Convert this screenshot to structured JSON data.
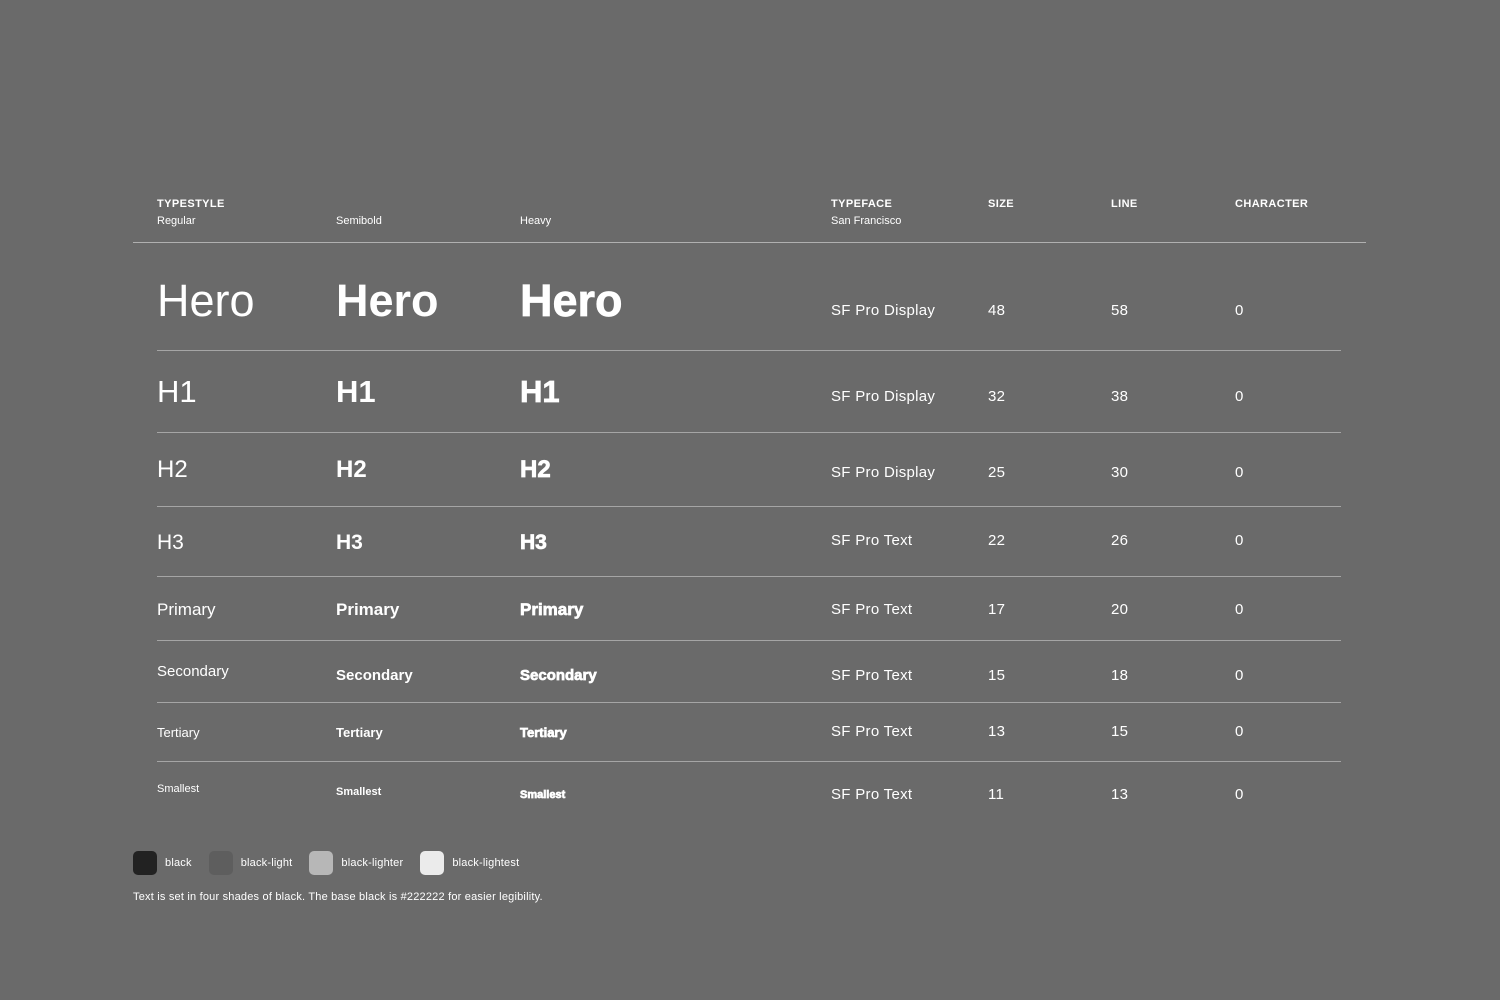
{
  "header": {
    "typestyle_label": "TYPESTYLE",
    "weights": [
      "Regular",
      "Semibold",
      "Heavy"
    ],
    "typeface_label": "TYPEFACE",
    "typeface_family": "San Francisco",
    "size_label": "SIZE",
    "line_label": "LINE",
    "character_label": "CHARACTER"
  },
  "rows": [
    {
      "name": "Hero",
      "typeface": "SF Pro Display",
      "size": "48",
      "line": "58",
      "character": "0"
    },
    {
      "name": "H1",
      "typeface": "SF Pro Display",
      "size": "32",
      "line": "38",
      "character": "0"
    },
    {
      "name": "H2",
      "typeface": "SF Pro Display",
      "size": "25",
      "line": "30",
      "character": "0"
    },
    {
      "name": "H3",
      "typeface": "SF Pro Text",
      "size": "22",
      "line": "26",
      "character": "0"
    },
    {
      "name": "Primary",
      "typeface": "SF Pro Text",
      "size": "17",
      "line": "20",
      "character": "0"
    },
    {
      "name": "Secondary",
      "typeface": "SF Pro Text",
      "size": "15",
      "line": "18",
      "character": "0"
    },
    {
      "name": "Tertiary",
      "typeface": "SF Pro Text",
      "size": "13",
      "line": "15",
      "character": "0"
    },
    {
      "name": "Smallest",
      "typeface": "SF Pro Text",
      "size": "11",
      "line": "13",
      "character": "0"
    }
  ],
  "legend": [
    {
      "label": "black",
      "color": "#222222"
    },
    {
      "label": "black-light",
      "color": "#5e5e5e"
    },
    {
      "label": "black-lighter",
      "color": "#b7b7b7"
    },
    {
      "label": "black-lightest",
      "color": "#ebebeb"
    }
  ],
  "footnote": "Text is set in four shades of black. The base black is #222222 for easier legibility."
}
